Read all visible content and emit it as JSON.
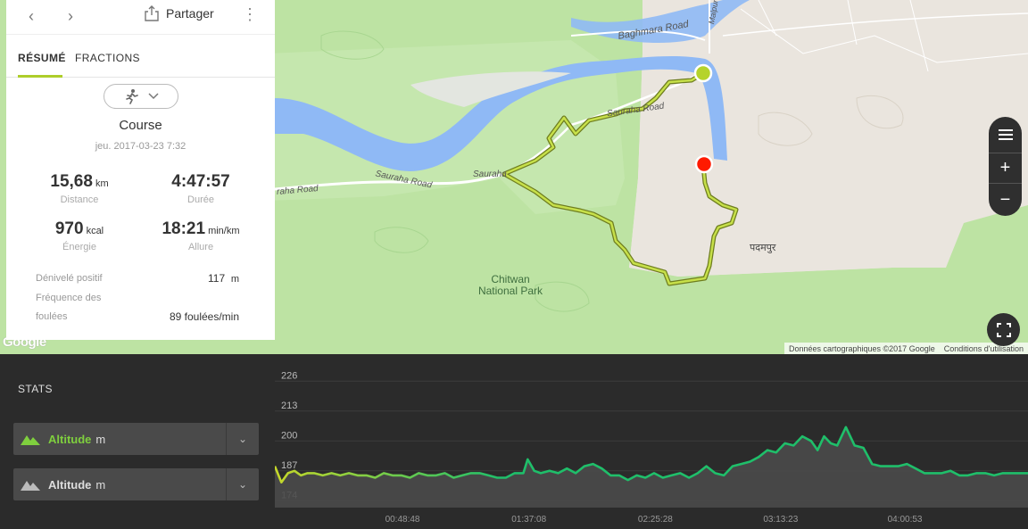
{
  "panel": {
    "share_label": "Partager",
    "tabs": [
      "RÉSUMÉ",
      "FRACTIONS"
    ],
    "sport": "Course",
    "date": "jeu. 2017-03-23 7:32",
    "stats": {
      "distance": {
        "value": "15,68",
        "unit": "km",
        "label": "Distance"
      },
      "duration": {
        "value": "4:47:57",
        "unit": "",
        "label": "Durée"
      },
      "energy": {
        "value": "970",
        "unit": "kcal",
        "label": "Énergie"
      },
      "pace": {
        "value": "18:21",
        "unit": "min/km",
        "label": "Allure"
      }
    },
    "ascent_label": "Dénivelé positif",
    "ascent_value": "117",
    "ascent_unit": "m",
    "cadence_label_1": "Fréquence des",
    "cadence_label_2": "foulées",
    "cadence_value": "89 foulées/min"
  },
  "map": {
    "labels": {
      "baghmara_road": "Baghmara Road",
      "sauraha_road_1": "Sauraha Road",
      "sauraha_road_2": "Sauraha",
      "sauraha_road_3": "Sauraha Road",
      "raha_road": "raha Road",
      "malpur": "Malpur R",
      "park_1": "Chitwan",
      "park_2": "National Park",
      "village": "पदमपुर"
    },
    "google": "Google",
    "attribution": "Données cartographiques ©2017 Google",
    "terms": "Conditions d'utilisation",
    "colors": {
      "route": "#aecd2a",
      "start": "#b5d32b",
      "end": "#ff1a00",
      "water": "#8fb9f5",
      "park": "#bde3a3"
    }
  },
  "bottom": {
    "stats_title": "STATS",
    "dropdown_1": {
      "name": "Altitude",
      "unit": "m",
      "color": "#7fcf3e"
    },
    "dropdown_2": {
      "name": "Altitude",
      "unit": "m",
      "color": "#cccccc"
    }
  },
  "chart_data": {
    "type": "line",
    "ylabel": "",
    "yticks": [
      174,
      187,
      200,
      213,
      226
    ],
    "ylim": [
      171,
      230
    ],
    "xticks": [
      "00:48:48",
      "01:37:08",
      "02:25:28",
      "03:13:23",
      "04:00:53"
    ],
    "xtick_positions_seconds": [
      2928,
      5828,
      8728,
      11603,
      14453
    ],
    "duration_seconds": 17277,
    "series": [
      {
        "name": "Altitude",
        "unit": "m",
        "color_start": "#c6d82a",
        "color_end": "#1fbf6a",
        "points_seconds": [
          0,
          150,
          300,
          450,
          600,
          750,
          900,
          1100,
          1300,
          1500,
          1700,
          1900,
          2100,
          2300,
          2500,
          2700,
          2900,
          3100,
          3300,
          3500,
          3700,
          3900,
          4100,
          4300,
          4500,
          4700,
          4900,
          5100,
          5300,
          5500,
          5700,
          5800,
          5950,
          6100,
          6300,
          6500,
          6700,
          6900,
          7100,
          7300,
          7500,
          7700,
          7900,
          8100,
          8300,
          8500,
          8700,
          8900,
          9100,
          9300,
          9500,
          9700,
          9900,
          10100,
          10300,
          10500,
          10700,
          10900,
          11100,
          11300,
          11500,
          11700,
          11900,
          12100,
          12300,
          12450,
          12600,
          12750,
          12900,
          13100,
          13300,
          13500,
          13700,
          13900,
          14100,
          14300,
          14500,
          14700,
          14900,
          15100,
          15300,
          15500,
          15700,
          15900,
          16100,
          16300,
          16500,
          16700,
          16900,
          17100,
          17277
        ],
        "values": [
          189,
          182,
          186,
          187,
          185,
          186,
          186,
          185,
          186,
          185,
          186,
          185,
          185,
          184,
          186,
          185,
          185,
          184,
          186,
          185,
          185,
          186,
          184,
          185,
          186,
          186,
          185,
          184,
          184,
          186,
          186,
          192,
          187,
          186,
          187,
          186,
          188,
          186,
          189,
          190,
          188,
          185,
          185,
          183,
          185,
          184,
          186,
          184,
          185,
          186,
          184,
          186,
          189,
          186,
          185,
          189,
          190,
          191,
          193,
          196,
          195,
          199,
          198,
          202,
          200,
          196,
          202,
          199,
          198,
          206,
          198,
          197,
          190,
          189,
          189,
          189,
          190,
          188,
          186,
          186,
          186,
          187,
          185,
          185,
          186,
          186,
          185,
          186,
          186,
          186,
          186
        ]
      }
    ]
  }
}
